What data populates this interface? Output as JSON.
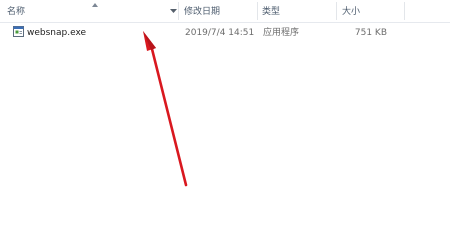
{
  "columns": {
    "name": "名称",
    "date_modified": "修改日期",
    "type": "类型",
    "size": "大小"
  },
  "files": [
    {
      "name": "websnap.exe",
      "date_modified": "2019/7/4 14:51",
      "type": "应用程序",
      "size": "751 KB",
      "icon": "application-exe-icon"
    }
  ],
  "annotation": {
    "type": "red-arrow",
    "color": "#d9181f",
    "points_to": "websnap.exe"
  },
  "colors": {
    "header_text": "#4d5c6e",
    "file_text": "#1e1e1e",
    "meta_text": "#6d6d6d"
  }
}
